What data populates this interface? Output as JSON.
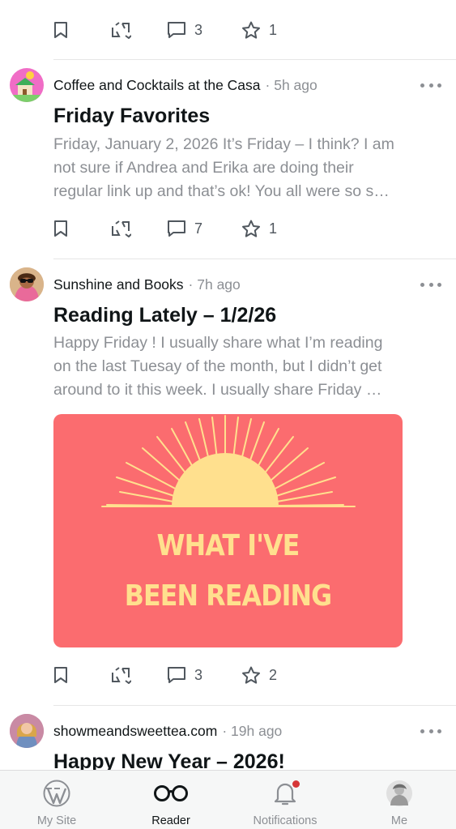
{
  "feed": {
    "top_actions": {
      "comments_count": "3",
      "likes_count": "1"
    },
    "posts": [
      {
        "site_name": "Coffee and Cocktails at the Casa",
        "time": "5h ago",
        "title": "Friday Favorites",
        "excerpt_lines": [
          "Friday, January 2, 2026 It’s Friday – I think? I am",
          "not sure if Andrea and Erika are doing their",
          "regular link up and that’s ok! You all were so s…"
        ],
        "comments_count": "7",
        "likes_count": "1"
      },
      {
        "site_name": "Sunshine and Books",
        "time": "7h ago",
        "title": "Reading Lately – 1/2/26",
        "excerpt_lines": [
          "Happy Friday ! I usually share what I’m reading",
          "on the last Tuesay of the month, but I didn’t get",
          "around to it this week. I usually share Friday …"
        ],
        "image_text_lines": [
          "WHAT I'VE",
          "BEEN READING"
        ],
        "comments_count": "3",
        "likes_count": "2"
      },
      {
        "site_name": "showmeandsweettea.com",
        "time": "19h ago",
        "title": "Happy New Year – 2026!"
      }
    ]
  },
  "tabbar": {
    "tabs": [
      {
        "label": "My Site",
        "icon": "wordpress-icon"
      },
      {
        "label": "Reader",
        "icon": "glasses-icon",
        "active": true
      },
      {
        "label": "Notifications",
        "icon": "bell-icon"
      },
      {
        "label": "Me",
        "icon": "profile-avatar"
      }
    ]
  },
  "colors": {
    "accent_red": "#d63638",
    "image_background": "#fb6c6f",
    "image_sun": "#ffe08e",
    "muted_text": "#8c8f94"
  }
}
